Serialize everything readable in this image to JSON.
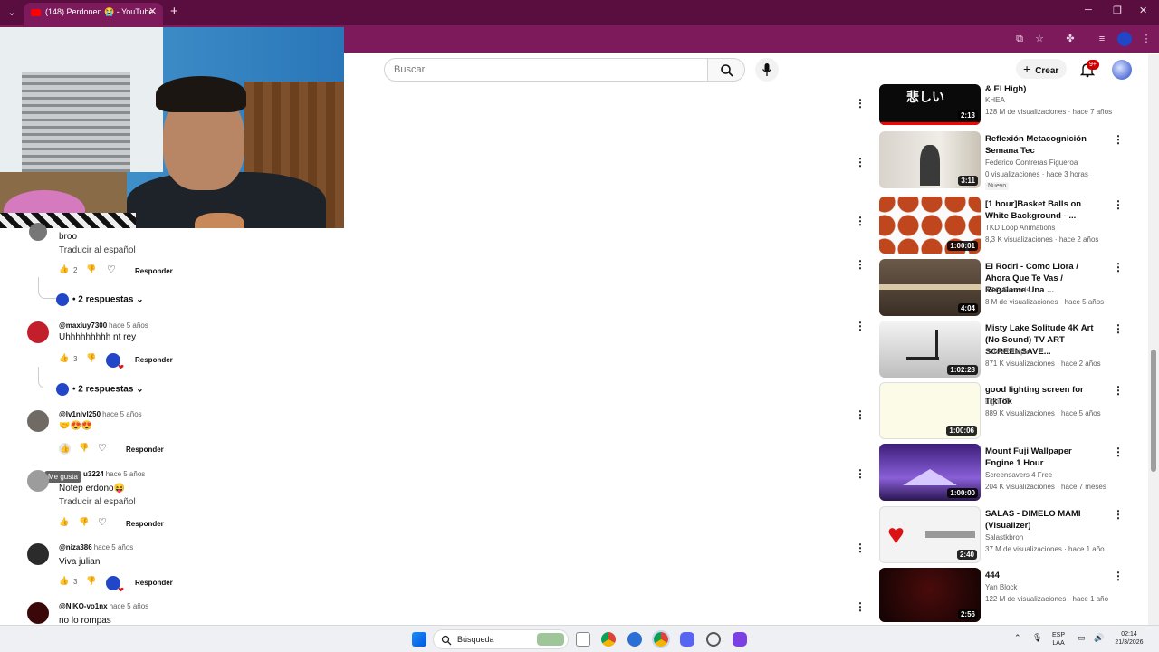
{
  "browser": {
    "tab_title": "(148) Perdonen 😭 - YouTube",
    "new_tab": "+",
    "min": "─",
    "max": "❐",
    "close": "✕",
    "tab_close": "✕",
    "tab_dd": "⌄"
  },
  "header": {
    "search_placeholder": "Buscar",
    "create_label": "Crear",
    "notif_badge": "9+"
  },
  "comments": [
    {
      "user": "",
      "time": "",
      "text": "broo",
      "translate": "Traducir al español",
      "likes": "2",
      "reply": "Responder",
      "replies": "• 2 respuestas"
    },
    {
      "user": "@maxiuy7300",
      "time": "hace 5 años",
      "text": "Uhhhhhhhhh nt rey",
      "likes": "3",
      "reply": "Responder",
      "replies": "• 2 respuestas"
    },
    {
      "user": "@lv1nlvl250",
      "time": "hace 5 años",
      "text": "🤝😍😍",
      "likes": "",
      "reply": "Responder"
    },
    {
      "user": "u3224",
      "time": "hace 5 años",
      "text": "Notep erdono😝",
      "translate": "Traducir al español",
      "reply": "Responder"
    },
    {
      "user": "@niza386",
      "time": "hace 5 años",
      "text": "Viva julian",
      "likes": "3",
      "reply": "Responder"
    },
    {
      "user": "@NIKO-vo1nx",
      "time": "hace 5 años",
      "text": "no lo rompas"
    }
  ],
  "tooltip": "Me gusta",
  "sidebar": [
    {
      "title": "& El High)",
      "channel": "KHEA",
      "meta": "128 M de visualizaciones · hace 7 años",
      "duration": "2:13"
    },
    {
      "title": "Reflexión Metacognición Semana Tec",
      "channel": "Federico Contreras Figueroa",
      "meta": "0 visualizaciones · hace 3 horas",
      "badge": "Nuevo",
      "duration": "3:11"
    },
    {
      "title": "[1 hour]Basket Balls on White Background - ...",
      "channel": "TKD Loop Animations",
      "meta": "8,3 K visualizaciones · hace 2 años",
      "duration": "1:00:01"
    },
    {
      "title": "El Rodri - Como Llora / Ahora Que Te Vas / Regalame Una ...",
      "channel": "KDG Records",
      "meta": "8 M de visualizaciones · hace 5 años",
      "duration": "4:04"
    },
    {
      "title": "Misty Lake Solitude 4K Art (No Sound) TV ART SCREENSAVE...",
      "channel": "ScreenScape",
      "meta": "871 K visualizaciones · hace 2 años",
      "duration": "1:02:28"
    },
    {
      "title": "good lighting screen for TikTok",
      "channel": "Light IT",
      "meta": "889 K visualizaciones · hace 5 años",
      "duration": "1:00:06"
    },
    {
      "title": "Mount Fuji Wallpaper Engine 1 Hour",
      "channel": "Screensavers 4 Free",
      "meta": "204 K visualizaciones · hace 7 meses",
      "duration": "1:00:00"
    },
    {
      "title": "SALAS - DIMELO MAMI (Visualizer)",
      "channel": "Salastkbron",
      "meta": "37 M de visualizaciones · hace 1 año",
      "duration": "2:40"
    },
    {
      "title": "444",
      "channel": "Yan Block",
      "meta": "122 M de visualizaciones · hace 1 año",
      "duration": "2:56"
    }
  ],
  "taskbar": {
    "search_label": "Búsqueda",
    "lang_top": "ESP",
    "lang_bottom": "LAA",
    "time": "02:14",
    "date": "21/3/2026"
  },
  "colors": {
    "tabbar": "#5a0e40",
    "toolbar": "#7c1a5c",
    "yt_red": "#ff0000"
  }
}
